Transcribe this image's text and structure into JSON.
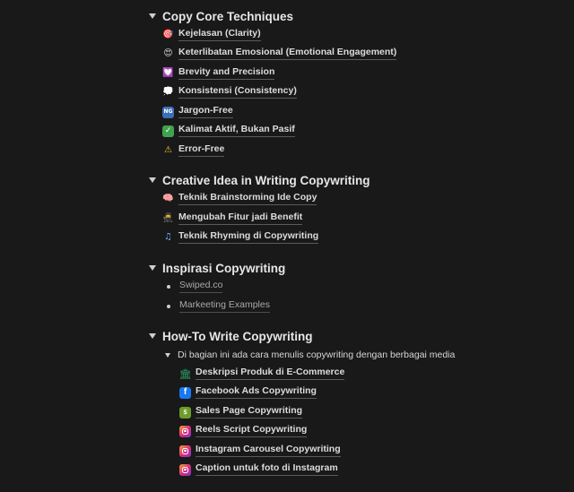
{
  "sections": {
    "core": {
      "title": "Copy Core Techniques",
      "items": [
        {
          "icon": "target-icon",
          "label": "Kejelasan (Clarity)"
        },
        {
          "icon": "heart-eyes-icon",
          "label": "Keterlibatan Emosional (Emotional Engagement)"
        },
        {
          "icon": "heart-box-icon",
          "label": "Brevity and Precision"
        },
        {
          "icon": "speech-bubble-icon",
          "label": "Konsistensi (Consistency)"
        },
        {
          "icon": "ng-button-icon",
          "label": "Jargon-Free"
        },
        {
          "icon": "check-mark-icon",
          "label": "Kalimat Aktif, Bukan Pasif"
        },
        {
          "icon": "warning-icon",
          "label": "Error-Free"
        }
      ]
    },
    "creative": {
      "title": "Creative Idea in Writing Copywriting",
      "items": [
        {
          "icon": "brain-icon",
          "label": "Teknik Brainstorming Ide Copy"
        },
        {
          "icon": "ninja-icon",
          "label": "Mengubah Fitur jadi Benefit"
        },
        {
          "icon": "music-notes-icon",
          "label": "Teknik Rhyming di Copywriting"
        }
      ]
    },
    "inspirasi": {
      "title": "Inspirasi Copywriting",
      "items": [
        {
          "label": "Swiped.co"
        },
        {
          "label": "Markeeting Examples"
        }
      ]
    },
    "howto": {
      "title": "How-To Write Copywriting",
      "sub_toggle": "Di bagian ini ada cara menulis copywriting dengan berbagai media",
      "items": [
        {
          "icon": "bank-icon",
          "label": "Deskripsi Produk di E-Commerce"
        },
        {
          "icon": "facebook-icon",
          "label": "Facebook Ads Copywriting"
        },
        {
          "icon": "money-icon",
          "label": "Sales Page Copywriting"
        },
        {
          "icon": "instagram-icon",
          "label": "Reels Script Copywriting"
        },
        {
          "icon": "instagram-icon",
          "label": "Instagram Carousel Copywriting"
        },
        {
          "icon": "instagram-icon",
          "label": "Caption untuk foto di Instagram"
        }
      ]
    }
  },
  "colors": {
    "background": "#191919",
    "facebook": "#1877f2",
    "instagram": "#d6297c",
    "bank": "#2aa36b",
    "money": "#8fbf3a"
  }
}
